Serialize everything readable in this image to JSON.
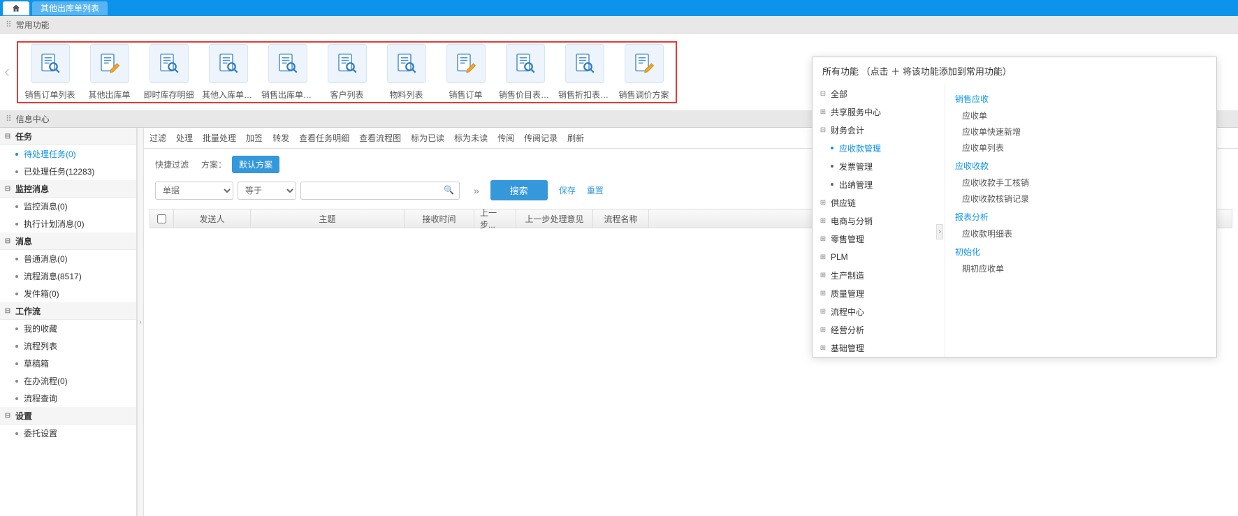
{
  "tabs": {
    "other": "其他出库单列表"
  },
  "section": {
    "common": "常用功能",
    "info": "信息中心"
  },
  "funcs": [
    {
      "label": "销售订单列表",
      "type": "search"
    },
    {
      "label": "其他出库单",
      "type": "edit"
    },
    {
      "label": "即时库存明细",
      "type": "search"
    },
    {
      "label": "其他入库单列...",
      "type": "search"
    },
    {
      "label": "销售出库单列...",
      "type": "search"
    },
    {
      "label": "客户列表",
      "type": "search"
    },
    {
      "label": "物料列表",
      "type": "search"
    },
    {
      "label": "销售订单",
      "type": "edit"
    },
    {
      "label": "销售价目表列...",
      "type": "search"
    },
    {
      "label": "销售折扣表列...",
      "type": "search"
    },
    {
      "label": "销售调价方案",
      "type": "edit"
    }
  ],
  "side": {
    "task": "任务",
    "task_pending": "待处理任务(0)",
    "task_done": "已处理任务(12283)",
    "monitor": "监控消息",
    "monitor_msg": "监控消息(0)",
    "monitor_plan": "执行计划消息(0)",
    "msg": "消息",
    "msg_common": "普通消息(0)",
    "msg_flow": "流程消息(8517)",
    "msg_out": "发件箱(0)",
    "workflow": "工作流",
    "wf_fav": "我的收藏",
    "wf_list": "流程列表",
    "wf_draft": "草稿箱",
    "wf_doing": "在办流程(0)",
    "wf_query": "流程查询",
    "settings": "设置",
    "set_delegate": "委托设置"
  },
  "toolbar": {
    "filter": "过滤",
    "process": "处理",
    "batch": "批量处理",
    "sign": "加签",
    "forward": "转发",
    "detail": "查看任务明细",
    "flow": "查看流程图",
    "read": "标为已读",
    "unread": "标为未读",
    "circ": "传阅",
    "circ_rec": "传阅记录",
    "refresh": "刷新"
  },
  "filter": {
    "quick": "快捷过滤",
    "scheme": "方案：",
    "default_scheme": "默认方案",
    "sel1": "单据",
    "sel2": "等于",
    "placeholder": "",
    "search": "搜索",
    "save": "保存",
    "reset": "重置"
  },
  "grid": {
    "sender": "发送人",
    "subject": "主题",
    "recv": "接收时间",
    "last_step": "上一步...",
    "last_opinion": "上一步处理意见",
    "flow_name": "流程名称"
  },
  "popup": {
    "title": "所有功能  （点击 ＋ 将该功能添加到常用功能）",
    "tree": {
      "all": "全部",
      "share": "共享服务中心",
      "finance": "财务会计",
      "ar": "应收款管理",
      "invoice": "发票管理",
      "cashier": "出纳管理",
      "supply": "供应链",
      "ecom": "电商与分销",
      "retail": "零售管理",
      "plm": "PLM",
      "mfg": "生产制造",
      "quality": "质量管理",
      "flowcenter": "流程中心",
      "analysis": "经营分析",
      "basic": "基础管理"
    },
    "list": {
      "h1": "销售应收",
      "l1": "应收单",
      "l2": "应收单快速新增",
      "l3": "应收单列表",
      "h2": "应收收款",
      "l4": "应收收款手工核销",
      "l5": "应收收款核销记录",
      "h3": "报表分析",
      "l6": "应收款明细表",
      "h4": "初始化",
      "l7": "期初应收单"
    }
  }
}
